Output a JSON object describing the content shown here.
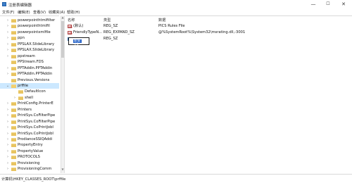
{
  "window": {
    "title": "注册表编辑器",
    "minimize": "—",
    "maximize": "☐",
    "close": "✕"
  },
  "menu": [
    "文件(F)",
    "编辑(E)",
    "查看(V)",
    "收藏夹(A)",
    "帮助(H)"
  ],
  "tree": {
    "items": [
      {
        "label": "powerpointhtmlfilter",
        "expandable": true,
        "indent": 1
      },
      {
        "label": "powerpointhtmlfil",
        "expandable": true,
        "indent": 1
      },
      {
        "label": "powerpointxmlfile",
        "expandable": true,
        "indent": 1
      },
      {
        "label": "ppn",
        "expandable": true,
        "indent": 1
      },
      {
        "label": "PPSLAX.SlideLibrary",
        "expandable": true,
        "indent": 1
      },
      {
        "label": "PPSLAX.SlideLibrary",
        "expandable": true,
        "indent": 1
      },
      {
        "label": "ppstream",
        "expandable": true,
        "indent": 1
      },
      {
        "label": "PPStream.FDS",
        "expandable": false,
        "indent": 1
      },
      {
        "label": "PPTAddin.PPTAddin",
        "expandable": true,
        "indent": 1
      },
      {
        "label": "PPTAddin.PPTAddin",
        "expandable": true,
        "indent": 1
      },
      {
        "label": "Previous.Versions",
        "expandable": false,
        "indent": 1
      },
      {
        "label": "prffile",
        "expandable": true,
        "expanded": true,
        "indent": 1,
        "selected": true
      },
      {
        "label": "DefaultIcon",
        "expandable": false,
        "indent": 2
      },
      {
        "label": "shell",
        "expandable": true,
        "indent": 2
      },
      {
        "label": "PrintConfig.PrinterE",
        "expandable": true,
        "indent": 1
      },
      {
        "label": "Printers",
        "expandable": true,
        "indent": 1
      },
      {
        "label": "PrintSys.CoFilterPipe",
        "expandable": true,
        "indent": 1
      },
      {
        "label": "PrintSys.CoFilterPipe",
        "expandable": true,
        "indent": 1
      },
      {
        "label": "PrintSys.CoPrintJobI",
        "expandable": true,
        "indent": 1
      },
      {
        "label": "PrintSys.CoPrintJobI",
        "expandable": true,
        "indent": 1
      },
      {
        "label": "ProdianceSSIQAddi",
        "expandable": true,
        "indent": 1
      },
      {
        "label": "PropertyEntry",
        "expandable": true,
        "indent": 1
      },
      {
        "label": "PropertyValue",
        "expandable": true,
        "indent": 1
      },
      {
        "label": "PROTOCOLS",
        "expandable": true,
        "indent": 1
      },
      {
        "label": "Provisioning",
        "expandable": true,
        "indent": 1
      },
      {
        "label": "ProvisioningComm",
        "expandable": true,
        "indent": 1
      }
    ]
  },
  "values": {
    "headers": {
      "name": "名称",
      "type": "类型",
      "data": "数据"
    },
    "rows": [
      {
        "icon": "ab",
        "name": "(默认)",
        "type": "REG_SZ",
        "data": "PICS Rules File"
      },
      {
        "icon": "ab",
        "name": "FriendlyTypeN...",
        "type": "REG_EXPAND_SZ",
        "data": "@%SystemRoot%\\System32\\msrating.dll,-3001"
      },
      {
        "icon": "011",
        "name": "",
        "type": "REG_SZ",
        "data": ""
      }
    ],
    "editing_text": "新值 #1"
  },
  "status": {
    "path": "计算机\\HKEY_CLASSES_ROOT\\prffile"
  }
}
